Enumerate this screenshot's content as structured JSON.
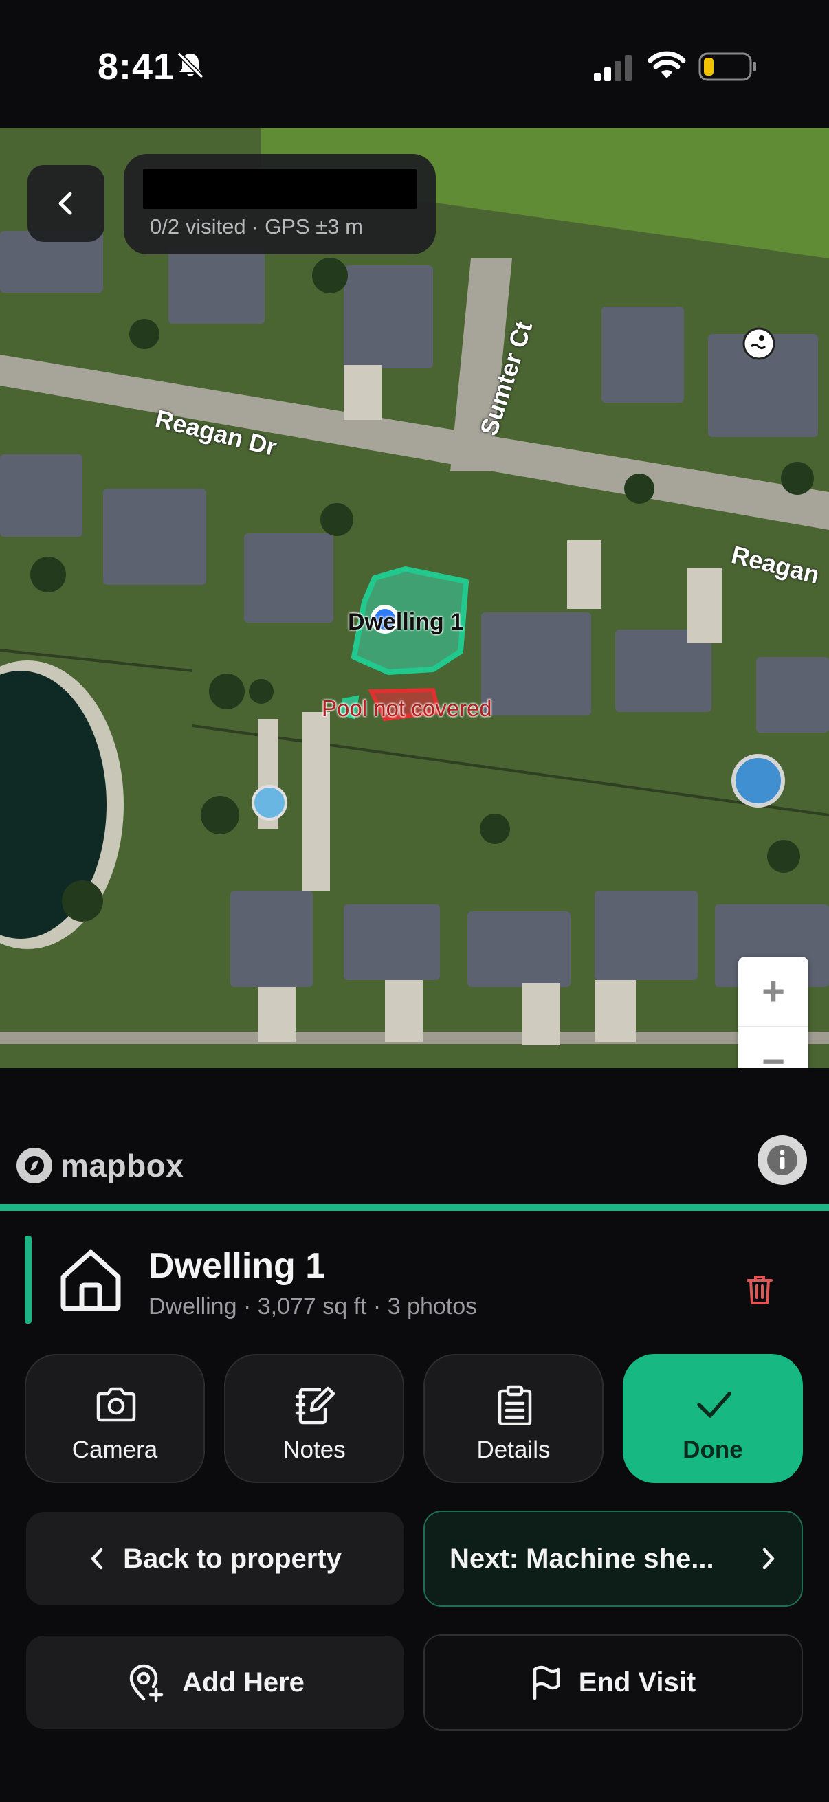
{
  "status_bar": {
    "time": "8:41",
    "icons": [
      "bell-slash-icon",
      "cellular-signal-icon",
      "wifi-icon",
      "battery-low-icon"
    ]
  },
  "map": {
    "header": {
      "title_redacted": true,
      "subtitle": "0/2 visited · GPS ±3 m"
    },
    "labels": {
      "street_reagan_dr": "Reagan Dr",
      "street_sumter_ct": "Sumter Ct",
      "street_reagan_right": "Reagan",
      "dwelling": "Dwelling 1",
      "pool": "Pool not covered"
    },
    "zoom": {
      "in": "+",
      "out": "−"
    },
    "attribution": "mapbox",
    "colors": {
      "dwelling_outline": "#22c98e",
      "pool_outline": "#e03030",
      "gps_dot": "#2f7bf5"
    }
  },
  "sheet": {
    "accent_color": "#1fb486",
    "item": {
      "title": "Dwelling 1",
      "meta": "Dwelling · 3,077 sq ft · 3 photos",
      "icon": "house-icon"
    },
    "actions": [
      {
        "label": "Camera",
        "icon": "camera-icon"
      },
      {
        "label": "Notes",
        "icon": "notes-icon"
      },
      {
        "label": "Details",
        "icon": "clipboard-icon"
      },
      {
        "label": "Done",
        "icon": "checkmark-icon"
      }
    ],
    "back_to_property": "Back to property",
    "next": "Next: Machine she...",
    "add_here": "Add Here",
    "end_visit": "End Visit"
  }
}
